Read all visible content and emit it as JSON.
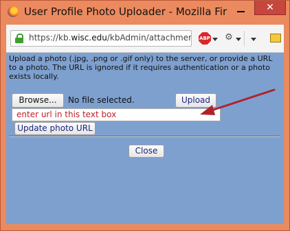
{
  "window": {
    "title": "User Profile Photo Uploader - Mozilla Fir",
    "minimize_glyph": "—",
    "close_glyph": "✕"
  },
  "navbar": {
    "url_prefix": "https://kb.",
    "url_domain": "wisc.edu",
    "url_rest": "/kbAdmin/attachmer",
    "abp_label": "ABP"
  },
  "page": {
    "instructions": "Upload a photo (.jpg, .png or .gif only) to the server, or provide a URL to a photo. The URL is ignored if it requires authentication or a photo exists locally.",
    "browse_label": "Browse...",
    "file_status": "No file selected.",
    "upload_label": "Upload",
    "url_input_value": "enter url in this text box",
    "update_label": "Update photo URL",
    "close_label": "Close"
  },
  "colors": {
    "window_frame": "#ec8a5f",
    "content_bg": "#7ea0cf",
    "annotation": "#c0202a",
    "button_text": "#1a237e"
  }
}
